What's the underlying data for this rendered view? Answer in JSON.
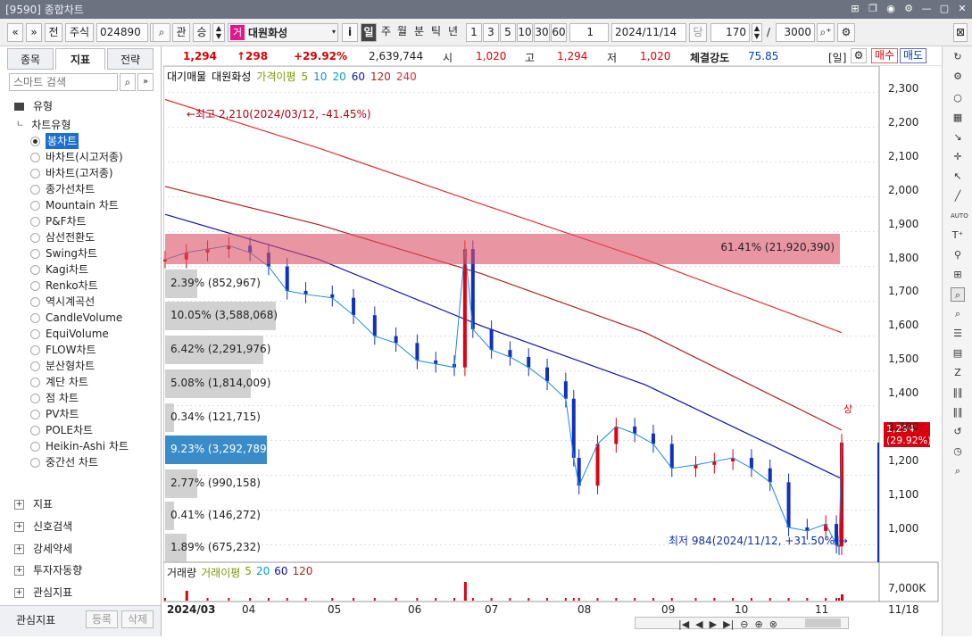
{
  "window": {
    "title": "[9590] 종합차트"
  },
  "toolbar": {
    "nav_prev": "«",
    "nav_down": "»",
    "before": "전",
    "type_select": "주식",
    "code": "024890",
    "search_icon": "search-icon",
    "gwan": "관",
    "seung": "승",
    "stock_badge": "거",
    "stock_name": "대원화성",
    "info_btn": "i",
    "periods": [
      "일",
      "주",
      "월",
      "분",
      "틱",
      "년"
    ],
    "numbers": [
      "1",
      "3",
      "5",
      "10",
      "30",
      "60"
    ],
    "count_select": "1",
    "date": "2024/11/14",
    "dang": "당",
    "view_count": "170",
    "slash": "/",
    "total_count": "3000"
  },
  "left": {
    "tabs": [
      "종목",
      "지표",
      "전략"
    ],
    "search_placeholder": "스마트 검색",
    "type_header": "유형",
    "chart_type_header": "차트유형",
    "chart_types": [
      "봉차트",
      "바차트(시고저종)",
      "바차트(고저종)",
      "종가선차트",
      "Mountain 차트",
      "P&F차트",
      "삼선전환도",
      "Swing차트",
      "Kagi차트",
      "Renko차트",
      "역시계곡선",
      "CandleVolume",
      "EquiVolume",
      "FLOW차트",
      "분산형차트",
      "계단 차트",
      "점 차트",
      "PV차트",
      "POLE차트",
      "Heikin-Ashi 차트",
      "중간선 차트"
    ],
    "sections": [
      "지표",
      "신호검색",
      "강세약세",
      "투자자동향",
      "관심지표"
    ],
    "footer_label": "관심지표",
    "register_btn": "등록",
    "delete_btn": "삭제"
  },
  "info": {
    "price": "1,294",
    "change": "↑298",
    "change_pct": "+29.92%",
    "volume": "2,639,744",
    "open_label": "시",
    "open": "1,020",
    "high_label": "고",
    "high": "1,294",
    "low_label": "저",
    "low": "1,020",
    "strength_label": "체결강도",
    "strength": "75.85",
    "period_badge": "[일]",
    "buy": "매수",
    "sell": "매도"
  },
  "legend": {
    "label1": "대기매물",
    "label2": "대원화성",
    "ma_label": "가격이평",
    "ma_values": [
      "5",
      "10",
      "20",
      "60",
      "120",
      "240"
    ],
    "ma_colors": [
      "#7a9a00",
      "#1a8cd8",
      "#00a0d0",
      "#1010b0",
      "#b02020",
      "#e03030"
    ]
  },
  "annotations": {
    "high": "←최고 2,210(2024/03/12, -41.45%)",
    "low": "최저 984(2024/11/12, +31.50%)→",
    "sang": "상",
    "price_tag": "1,294",
    "price_tag_pct": "(29.92%)"
  },
  "supply_bars": [
    {
      "label": "61.41% (21,920,390)",
      "pct": 61.41,
      "highlight": "red"
    },
    {
      "label": "2.39% (852,967)",
      "pct": 2.39
    },
    {
      "label": "10.05% (3,588,068)",
      "pct": 10.05
    },
    {
      "label": "6.42% (2,291,976)",
      "pct": 6.42
    },
    {
      "label": "5.08% (1,814,009)",
      "pct": 5.08
    },
    {
      "label": "0.34% (121,715)",
      "pct": 0.34
    },
    {
      "label": "9.23% (3,292,789)",
      "pct": 9.23,
      "highlight": "blue"
    },
    {
      "label": "2.77% (990,158)",
      "pct": 2.77
    },
    {
      "label": "0.41% (146,272)",
      "pct": 0.41
    },
    {
      "label": "1.89% (675,232)",
      "pct": 1.89
    }
  ],
  "price_axis": [
    "2,300",
    "2,200",
    "2,100",
    "2,000",
    "1,900",
    "1,800",
    "1,700",
    "1,600",
    "1,500",
    "1,400",
    "1,300",
    "1,200",
    "1,100",
    "1,000"
  ],
  "volume_panel": {
    "label": "거래량",
    "ma_label": "거래이평",
    "ma_values": [
      "5",
      "20",
      "60",
      "120"
    ],
    "axis": "7,000K"
  },
  "x_axis": [
    "2024/03",
    "04",
    "05",
    "06",
    "07",
    "08",
    "09",
    "10",
    "11"
  ],
  "x_end": "11/18",
  "chart_data": {
    "type": "candlestick",
    "ylim": [
      950,
      2330
    ],
    "close_path": [
      [
        "2024-03-04",
        1820
      ],
      [
        "2024-03-12",
        1840
      ],
      [
        "2024-03-20",
        1850
      ],
      [
        "2024-03-28",
        1860
      ],
      [
        "2024-04-05",
        1840
      ],
      [
        "2024-04-12",
        1800
      ],
      [
        "2024-04-19",
        1730
      ],
      [
        "2024-04-26",
        1720
      ],
      [
        "2024-05-06",
        1710
      ],
      [
        "2024-05-14",
        1660
      ],
      [
        "2024-05-22",
        1600
      ],
      [
        "2024-05-30",
        1580
      ],
      [
        "2024-06-07",
        1530
      ],
      [
        "2024-06-14",
        1520
      ],
      [
        "2024-06-21",
        1510
      ],
      [
        "2024-06-25",
        1850
      ],
      [
        "2024-06-28",
        1620
      ],
      [
        "2024-07-05",
        1560
      ],
      [
        "2024-07-12",
        1540
      ],
      [
        "2024-07-19",
        1510
      ],
      [
        "2024-07-26",
        1470
      ],
      [
        "2024-08-02",
        1420
      ],
      [
        "2024-08-05",
        1250
      ],
      [
        "2024-08-07",
        1170
      ],
      [
        "2024-08-14",
        1290
      ],
      [
        "2024-08-21",
        1340
      ],
      [
        "2024-08-28",
        1320
      ],
      [
        "2024-09-04",
        1290
      ],
      [
        "2024-09-11",
        1220
      ],
      [
        "2024-09-20",
        1230
      ],
      [
        "2024-09-27",
        1240
      ],
      [
        "2024-10-04",
        1250
      ],
      [
        "2024-10-11",
        1220
      ],
      [
        "2024-10-18",
        1180
      ],
      [
        "2024-10-25",
        1050
      ],
      [
        "2024-11-01",
        1040
      ],
      [
        "2024-11-08",
        1060
      ],
      [
        "2024-11-12",
        1000
      ],
      [
        "2024-11-13",
        996
      ],
      [
        "2024-11-14",
        1294
      ]
    ],
    "moving_averages": {
      "60": [
        [
          "2024-03-04",
          1950
        ],
        [
          "2024-05-01",
          1820
        ],
        [
          "2024-07-01",
          1630
        ],
        [
          "2024-09-01",
          1460
        ],
        [
          "2024-11-14",
          1190
        ]
      ],
      "120": [
        [
          "2024-03-04",
          2030
        ],
        [
          "2024-05-01",
          1920
        ],
        [
          "2024-07-01",
          1780
        ],
        [
          "2024-09-01",
          1610
        ],
        [
          "2024-11-14",
          1330
        ]
      ],
      "240": [
        [
          "2024-03-04",
          2280
        ],
        [
          "2024-05-01",
          2140
        ],
        [
          "2024-07-01",
          1980
        ],
        [
          "2024-09-01",
          1820
        ],
        [
          "2024-11-14",
          1610
        ]
      ]
    }
  },
  "bottom_controls": [
    "|◀",
    "◀",
    "▶",
    "▶|",
    "⊖",
    "⊕",
    "⊗"
  ]
}
